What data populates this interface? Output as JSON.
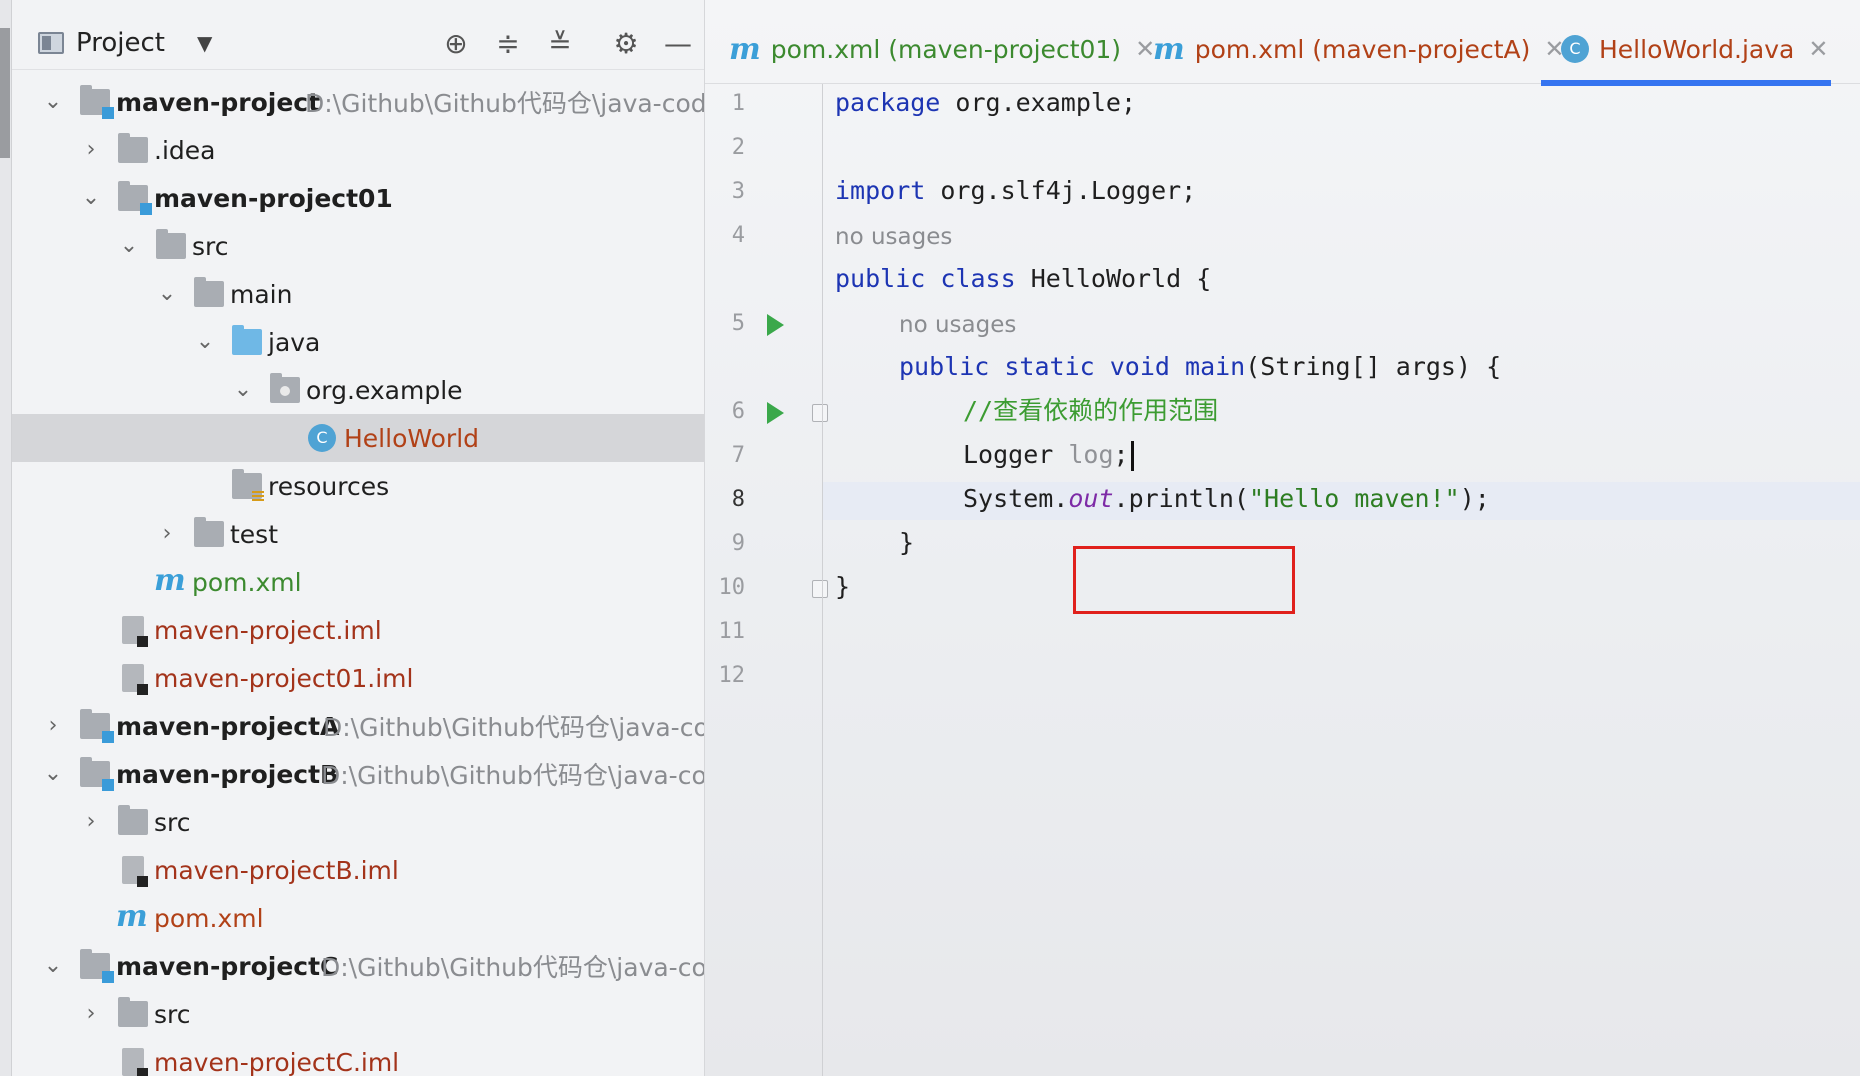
{
  "project_panel": {
    "title": "Project",
    "dropdown_icon": "chevron-down-icon",
    "tree": [
      {
        "label": "maven-project",
        "path": "D:\\Github\\Github代码仓\\java-code-",
        "bold": true,
        "expanded": true
      },
      {
        "label": ".idea",
        "expanded": false
      },
      {
        "label": "maven-project01",
        "bold": true,
        "expanded": true
      },
      {
        "label": "src",
        "expanded": true
      },
      {
        "label": "main",
        "expanded": true
      },
      {
        "label": "java",
        "expanded": true
      },
      {
        "label": "org.example",
        "expanded": true
      },
      {
        "label": "HelloWorld",
        "selected": true
      },
      {
        "label": "resources"
      },
      {
        "label": "test",
        "expanded": false
      },
      {
        "label": "pom.xml"
      },
      {
        "label": "maven-project.iml"
      },
      {
        "label": "maven-project01.iml"
      },
      {
        "label": "maven-projectA",
        "path": "D:\\Github\\Github代码仓\\java-code",
        "bold": true,
        "expanded": false
      },
      {
        "label": "maven-projectB",
        "path": "D:\\Github\\Github代码仓\\java-code",
        "bold": true,
        "expanded": true
      },
      {
        "label": "src",
        "expanded": false
      },
      {
        "label": "maven-projectB.iml"
      },
      {
        "label": "pom.xml"
      },
      {
        "label": "maven-projectC",
        "path": "D:\\Github\\Github代码仓\\java-code",
        "bold": true,
        "expanded": true
      },
      {
        "label": "src",
        "expanded": false
      },
      {
        "label": "maven-projectC.iml"
      }
    ]
  },
  "tabs": [
    {
      "label": "pom.xml (maven-project01)",
      "icon": "maven-icon",
      "color": "#3c8a2f"
    },
    {
      "label": "pom.xml (maven-projectA)",
      "icon": "maven-icon",
      "color": "#b14117"
    },
    {
      "label": "HelloWorld.java",
      "icon": "java-class-icon",
      "color": "#b14117",
      "active": true
    }
  ],
  "editor": {
    "line_numbers": [
      "1",
      "2",
      "3",
      "4",
      "5",
      "6",
      "7",
      "8",
      "9",
      "10",
      "11",
      "12"
    ],
    "hints": [
      "no usages",
      "no usages"
    ],
    "code": {
      "l1_kw": "package",
      "l1_rest": " org.example;",
      "l3_kw": "import",
      "l3_rest": " org.slf4j.Logger;",
      "l5_kw1": "public",
      "l5_kw2": "class",
      "l5_rest": " HelloWorld {",
      "l6_kw1": "public",
      "l6_kw2": "static",
      "l6_kw3": "void",
      "l6_fn": "main",
      "l6_rest": "(String[] args) {",
      "l7_comment": "//查看依赖的作用范围",
      "l8_type": "Logger ",
      "l8_var": "log",
      "l8_semicolon": ";",
      "l9_a": "System.",
      "l9_out": "out",
      "l9_b": ".println(",
      "l9_str": "\"Hello maven!\"",
      "l9_c": ");",
      "l10": "}",
      "l11": "}"
    }
  },
  "colors": {
    "keyword": "#1d35b3",
    "string": "#2d7d22",
    "comment": "#3c9c32",
    "highlight_box": "#e0201c",
    "tab_active_underline": "#3574f0"
  }
}
